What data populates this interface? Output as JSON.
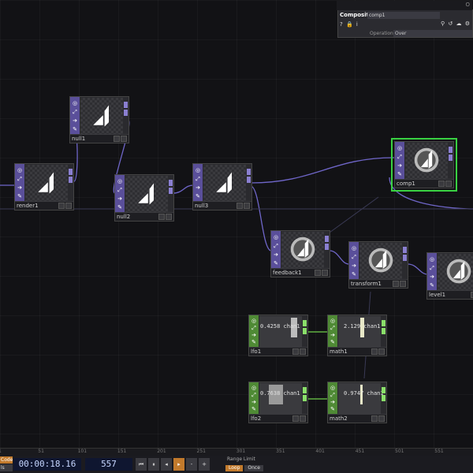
{
  "nodes": {
    "render1": {
      "label": "render1"
    },
    "null1": {
      "label": "null1"
    },
    "null2": {
      "label": "null2"
    },
    "null3": {
      "label": "null3"
    },
    "comp1": {
      "label": "comp1"
    },
    "feedback1": {
      "label": "feedback1"
    },
    "transform1": {
      "label": "transform1"
    },
    "level1": {
      "label": "level1"
    },
    "lfo1": {
      "label": "lfo1",
      "value": "0.4258",
      "channel": "chan1"
    },
    "math1": {
      "label": "math1",
      "value": "2.129",
      "channel": "chan1"
    },
    "lfo2": {
      "label": "lfo2",
      "value": "0.7638",
      "channel": "chan1"
    },
    "math2": {
      "label": "math2",
      "value": "0.9747",
      "channel": "chan1"
    }
  },
  "param_panel": {
    "type": "Composite",
    "name": "comp1",
    "param_label": "Operation",
    "param_value": "Over",
    "close": "O"
  },
  "ruler": {
    "ticks": [
      "1",
      "51",
      "101",
      "151",
      "201",
      "251",
      "301",
      "351",
      "401",
      "451",
      "501",
      "551"
    ]
  },
  "timebar": {
    "mode_top": "Code",
    "mode_bottom": "ls",
    "timecode": "00:00:18.16",
    "frame": "557",
    "range_limit_label": "Range Limit",
    "loop_label": "Loop",
    "once_label": "Once"
  },
  "colors": {
    "top_family": "#5a4f9a",
    "chop_family": "#4f8a35",
    "selected": "#39d142",
    "accent": "#c27a2c"
  }
}
